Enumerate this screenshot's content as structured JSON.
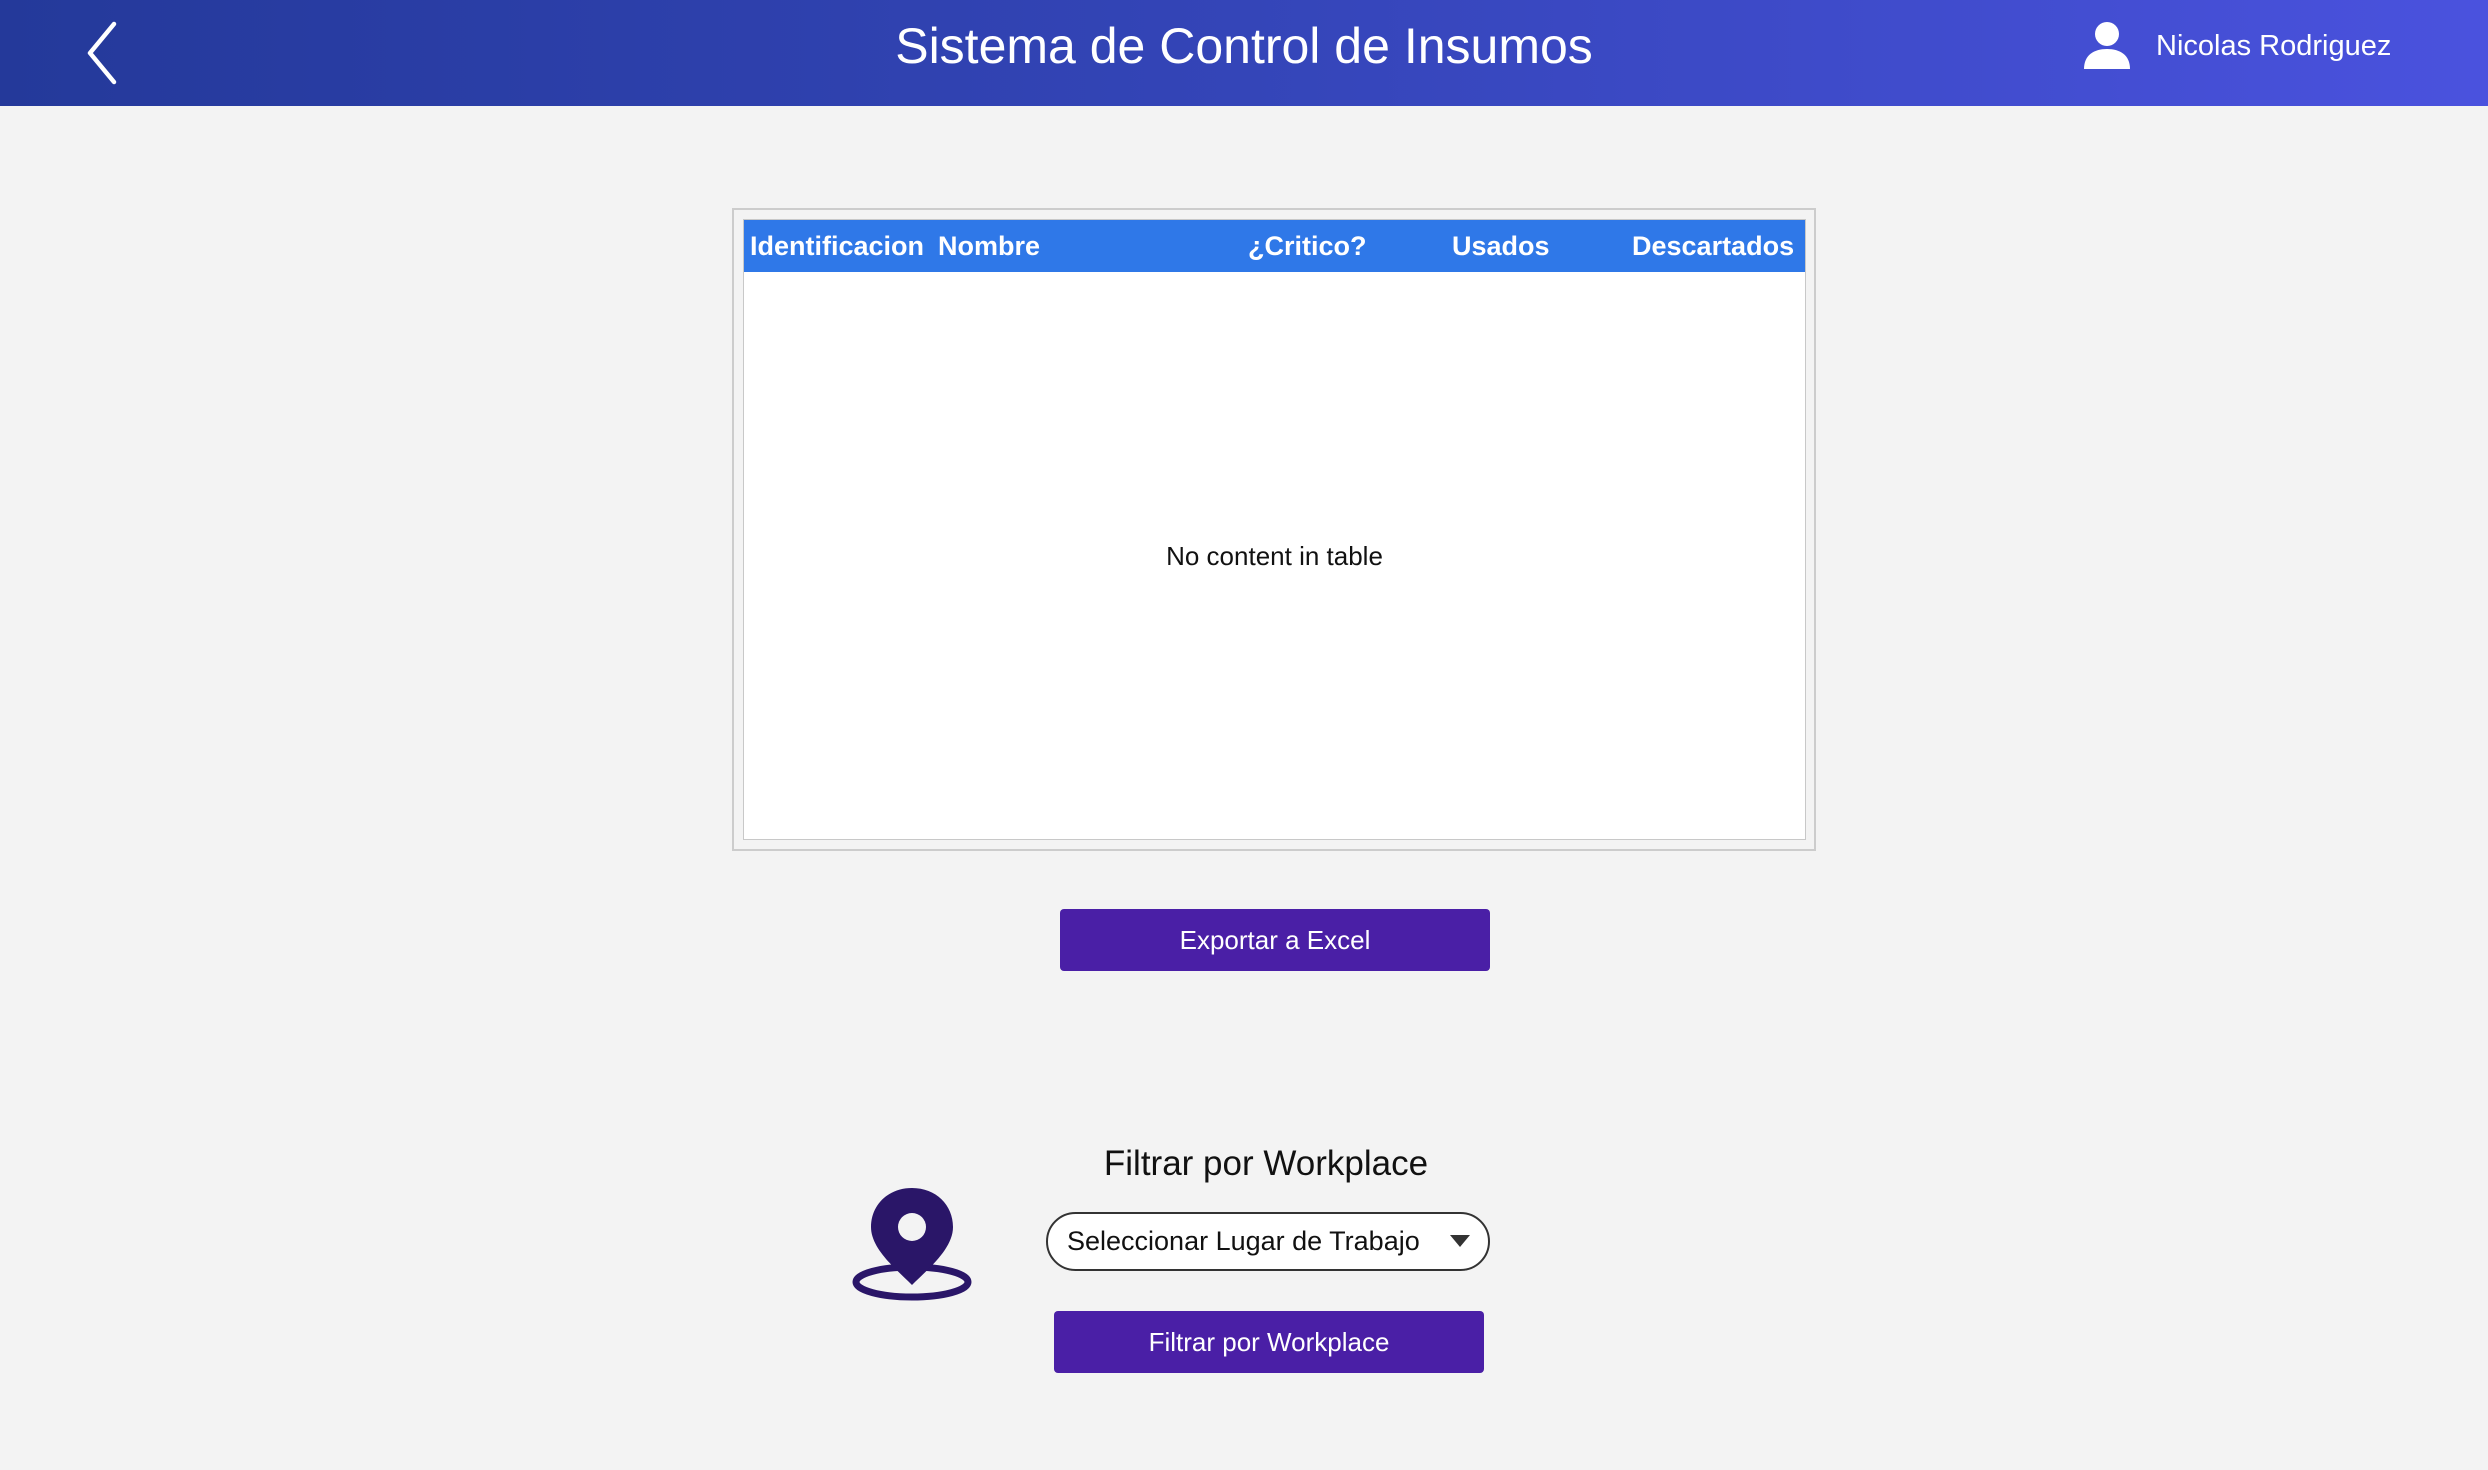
{
  "header": {
    "title": "Sistema de Control de Insumos",
    "user_name": "Nicolas Rodriguez",
    "back_icon": "chevron-left-icon",
    "user_icon": "user-icon"
  },
  "table": {
    "columns": [
      "Identificacion",
      "Nombre",
      "¿Critico?",
      "Usados",
      "Descartados"
    ],
    "rows": [],
    "empty_message": "No content in table",
    "header_color": "#2f78e8"
  },
  "actions": {
    "export_label": "Exportar a Excel"
  },
  "filter": {
    "title": "Filtrar por Workplace",
    "select_value": "Seleccionar Lugar de Trabajo",
    "button_label": "Filtrar por Workplace",
    "icon": "location-pin-icon"
  },
  "colors": {
    "header_gradient_start": "#24399a",
    "header_gradient_end": "#4a52de",
    "button": "#4a1fa6",
    "icon": "#2a1668",
    "background": "#f3f3f3"
  }
}
